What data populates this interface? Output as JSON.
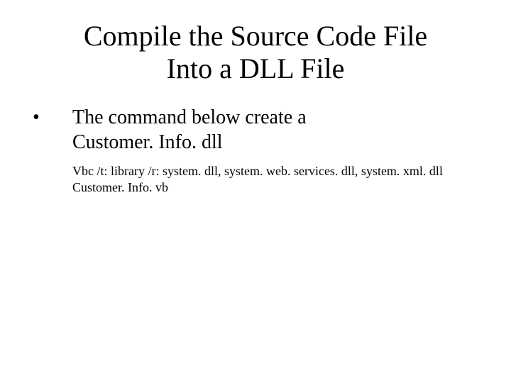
{
  "title_line1": "Compile the Source Code File",
  "title_line2": "Into a DLL File",
  "bullet_marker": "•",
  "lead_line1": "The command below create a",
  "lead_line2": "Customer. Info. dll",
  "cmd_line1": "Vbc /t: library  /r: system. dll, system. web. services. dll, system. xml. dll",
  "cmd_line2": "Customer. Info. vb"
}
